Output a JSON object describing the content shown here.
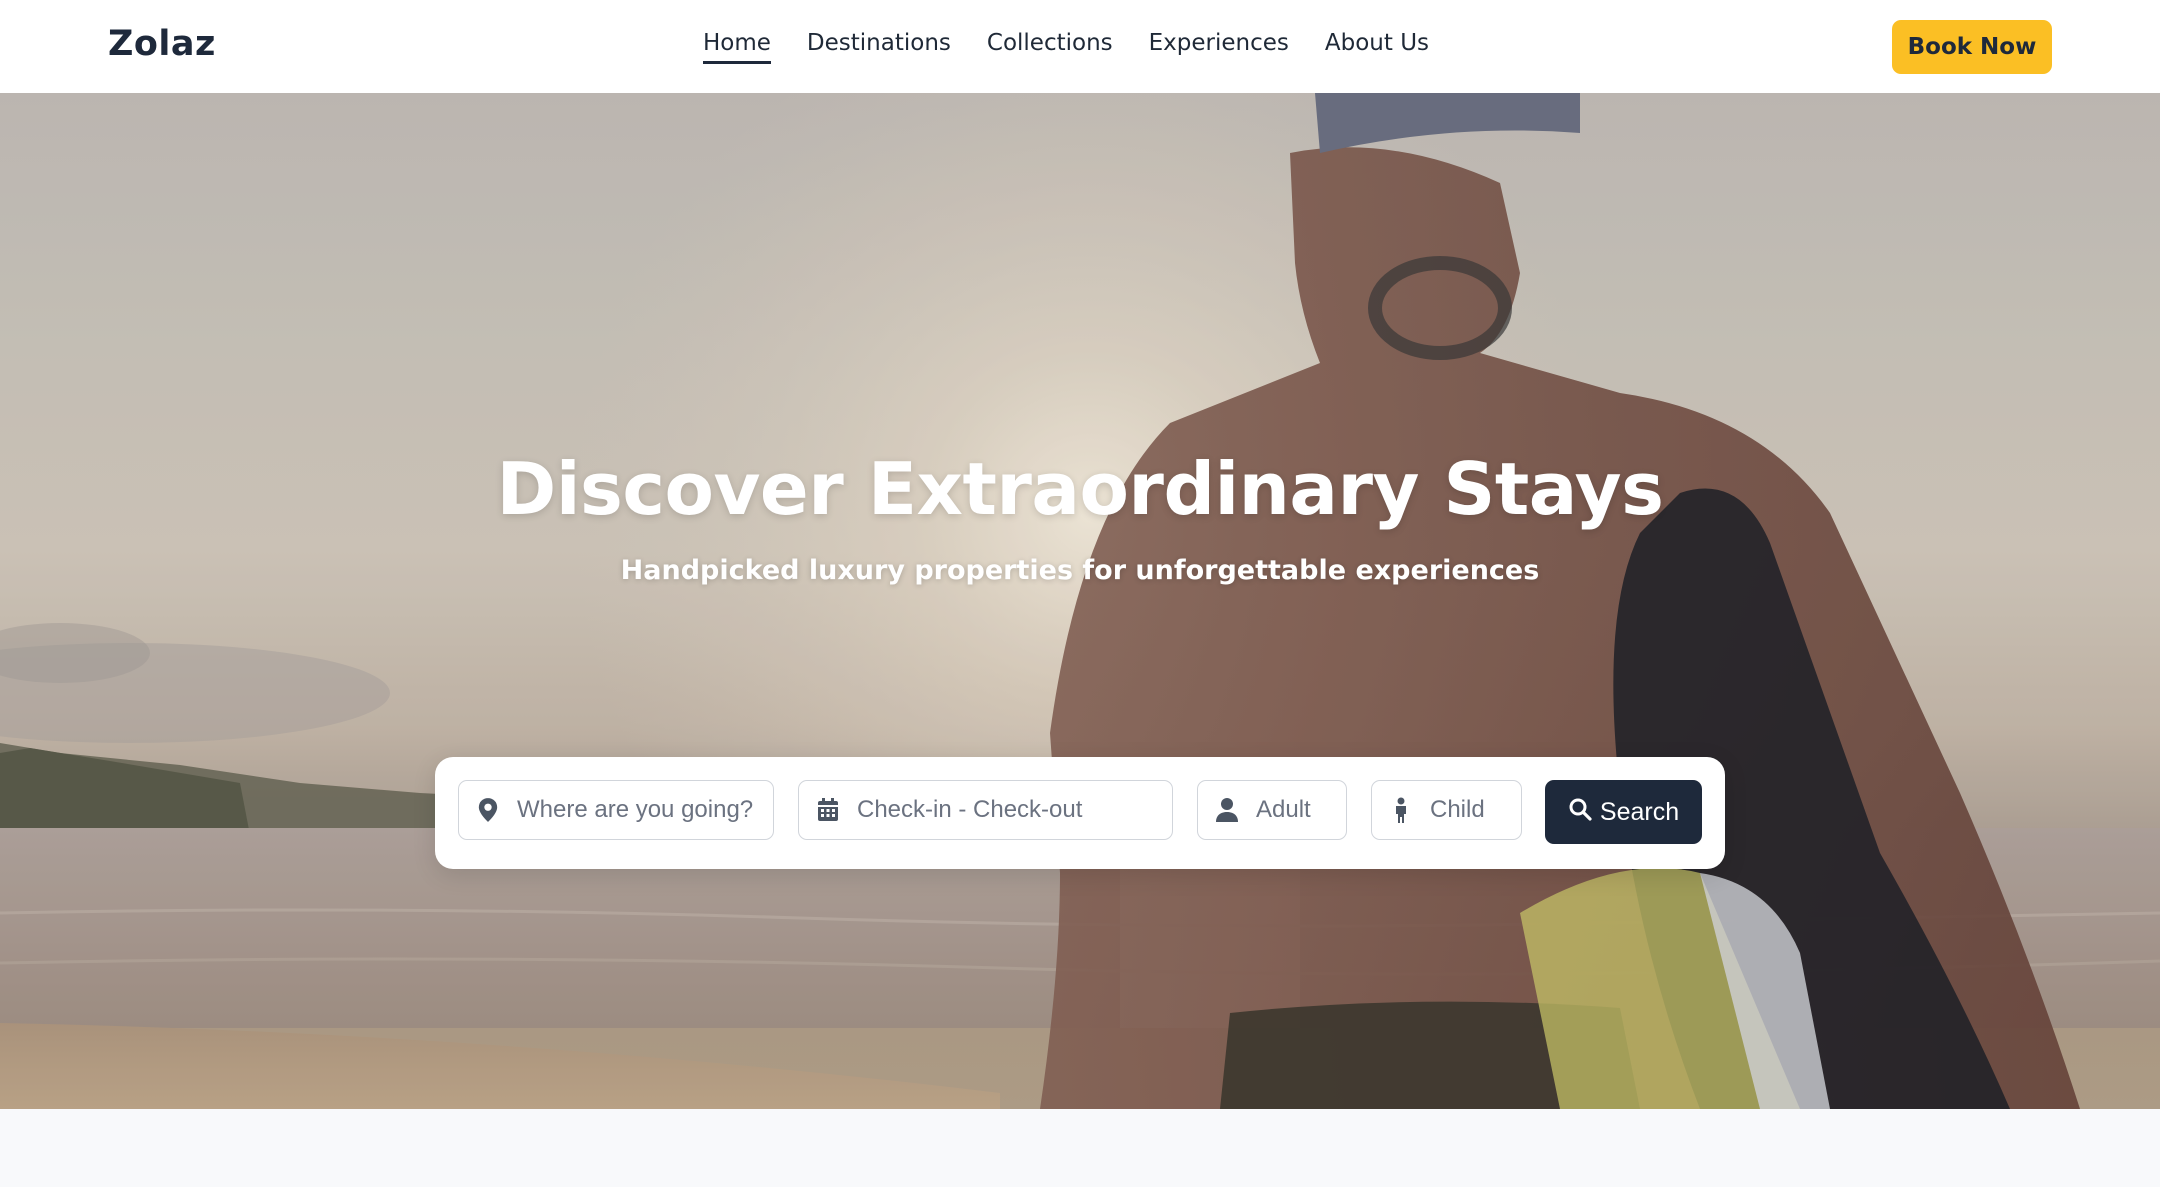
{
  "brand": {
    "name": "Zolaz",
    "accent": "#fbbf24",
    "dark": "#1e293b"
  },
  "nav": {
    "links": [
      {
        "label": "Home",
        "active": true
      },
      {
        "label": "Destinations",
        "active": false
      },
      {
        "label": "Collections",
        "active": false
      },
      {
        "label": "Experiences",
        "active": false
      },
      {
        "label": "About Us",
        "active": false
      }
    ],
    "cta_label": "Book Now"
  },
  "hero": {
    "title": "Discover Extraordinary Stays",
    "subtitle": "Handpicked luxury properties for unforgettable experiences"
  },
  "search": {
    "destination": {
      "placeholder": "Where are you going?",
      "value": "",
      "icon": "map-pin-icon"
    },
    "dates": {
      "placeholder": "Check-in - Check-out",
      "value": "",
      "icon": "calendar-icon"
    },
    "adult": {
      "placeholder": "Adult",
      "value": "",
      "icon": "user-icon"
    },
    "child": {
      "placeholder": "Child",
      "value": "",
      "icon": "child-icon"
    },
    "button_label": "Search",
    "button_icon": "search-icon"
  }
}
